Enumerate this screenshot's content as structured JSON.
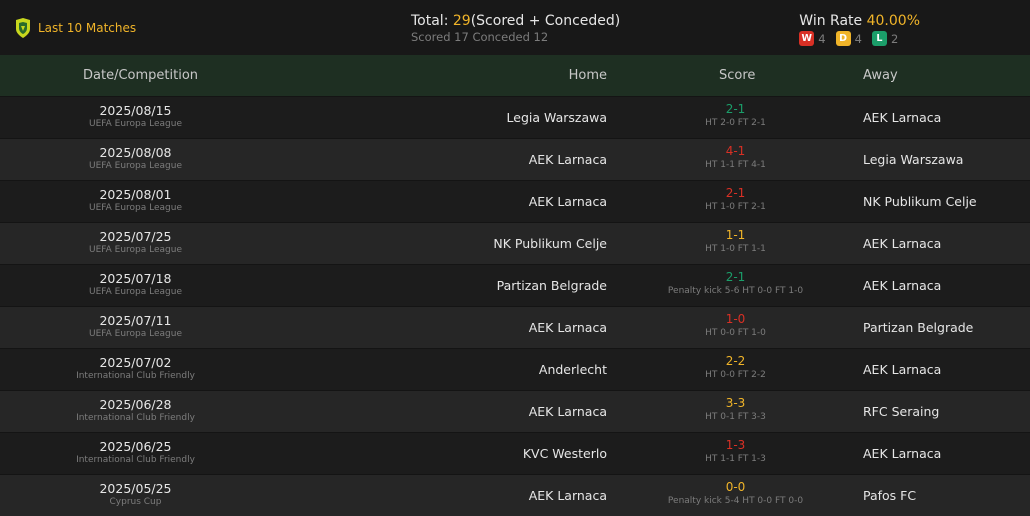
{
  "header": {
    "title": "Last 10 Matches",
    "total_label": "Total: ",
    "total_value": "29",
    "total_suffix": "(Scored + Conceded)",
    "scored_conceded": "Scored 17 Conceded 12",
    "winrate_label": "Win Rate ",
    "winrate_value": "40.00%",
    "wdl": [
      {
        "badge": "W",
        "count": "4"
      },
      {
        "badge": "D",
        "count": "4"
      },
      {
        "badge": "L",
        "count": "2"
      }
    ]
  },
  "columns": {
    "date": "Date/Competition",
    "home": "Home",
    "score": "Score",
    "away": "Away"
  },
  "colors": {
    "win": "#1b9e6a",
    "loss": "#d93025",
    "draw": "#f0b429",
    "header_bg": "#1e2f22"
  },
  "matches": [
    {
      "date": "2025/08/15",
      "comp": "UEFA Europa League",
      "home": "Legia Warszawa",
      "score": "2-1",
      "result": "win",
      "detail": "HT 2-0 FT 2-1",
      "away": "AEK Larnaca"
    },
    {
      "date": "2025/08/08",
      "comp": "UEFA Europa League",
      "home": "AEK Larnaca",
      "score": "4-1",
      "result": "loss",
      "detail": "HT 1-1 FT 4-1",
      "away": "Legia Warszawa"
    },
    {
      "date": "2025/08/01",
      "comp": "UEFA Europa League",
      "home": "AEK Larnaca",
      "score": "2-1",
      "result": "loss",
      "detail": "HT 1-0 FT 2-1",
      "away": "NK Publikum Celje"
    },
    {
      "date": "2025/07/25",
      "comp": "UEFA Europa League",
      "home": "NK Publikum Celje",
      "score": "1-1",
      "result": "draw",
      "detail": "HT 1-0 FT 1-1",
      "away": "AEK Larnaca"
    },
    {
      "date": "2025/07/18",
      "comp": "UEFA Europa League",
      "home": "Partizan Belgrade",
      "score": "2-1",
      "result": "win",
      "detail": "Penalty kick 5-6 HT 0-0 FT 1-0",
      "away": "AEK Larnaca"
    },
    {
      "date": "2025/07/11",
      "comp": "UEFA Europa League",
      "home": "AEK Larnaca",
      "score": "1-0",
      "result": "loss",
      "detail": "HT 0-0 FT 1-0",
      "away": "Partizan Belgrade"
    },
    {
      "date": "2025/07/02",
      "comp": "International Club Friendly",
      "home": "Anderlecht",
      "score": "2-2",
      "result": "draw",
      "detail": "HT 0-0 FT 2-2",
      "away": "AEK Larnaca"
    },
    {
      "date": "2025/06/28",
      "comp": "International Club Friendly",
      "home": "AEK Larnaca",
      "score": "3-3",
      "result": "draw",
      "detail": "HT 0-1 FT 3-3",
      "away": "RFC Seraing"
    },
    {
      "date": "2025/06/25",
      "comp": "International Club Friendly",
      "home": "KVC Westerlo",
      "score": "1-3",
      "result": "loss",
      "detail": "HT 1-1 FT 1-3",
      "away": "AEK Larnaca"
    },
    {
      "date": "2025/05/25",
      "comp": "Cyprus Cup",
      "home": "AEK Larnaca",
      "score": "0-0",
      "result": "draw",
      "detail": "Penalty kick 5-4 HT 0-0 FT 0-0",
      "away": "Pafos FC"
    }
  ]
}
